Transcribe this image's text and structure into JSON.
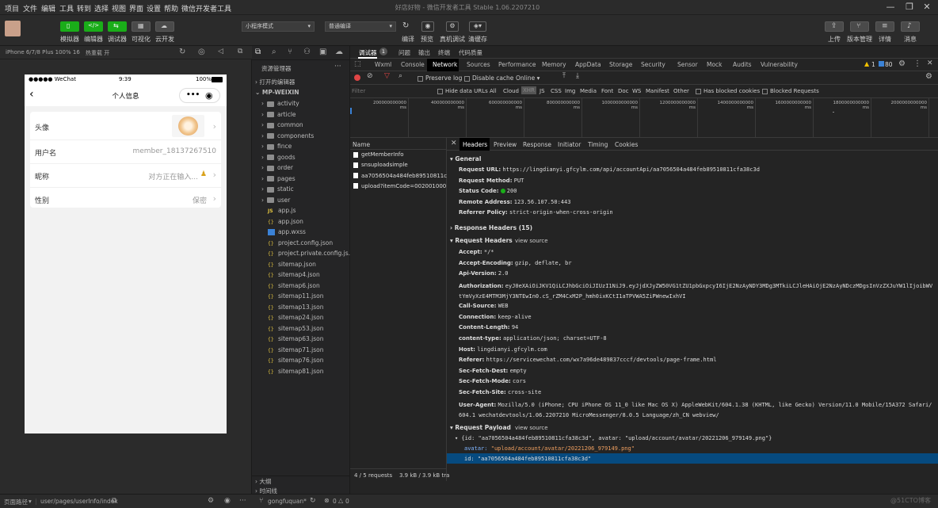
{
  "menubar": {
    "items": [
      "项目",
      "文件",
      "编辑",
      "工具",
      "转到",
      "选择",
      "视图",
      "界面",
      "设置",
      "帮助",
      "微信开发者工具"
    ],
    "window_title": "好店好物 - 微信开发者工具 Stable 1.06.2207210"
  },
  "toolbar": {
    "left_buttons": [
      "模拟器",
      "编辑器",
      "调试器",
      "可视化",
      "云开发"
    ],
    "mode_select": "小程序模式",
    "compile_select": "普通编译",
    "center_buttons": [
      "编译",
      "预览",
      "真机调试",
      "清缓存"
    ],
    "right_buttons": [
      "上传",
      "版本管理",
      "详情",
      "消息"
    ]
  },
  "simulator": {
    "device_select": "iPhone 6/7/8 Plus 100% 16",
    "hotreload": "热重载 开",
    "statusbar": {
      "carrier": "●●●●● WeChat",
      "time": "9:39",
      "battery": "100%"
    },
    "nav_title": "个人信息",
    "rows": [
      {
        "label": "头像",
        "value": ""
      },
      {
        "label": "用户名",
        "value": "member_18137267510"
      },
      {
        "label": "昵称",
        "value": "对方正在输入..."
      },
      {
        "label": "性别",
        "value": "保密"
      }
    ]
  },
  "explorer": {
    "title": "资源管理器",
    "open_editors": "打开的编辑器",
    "project": "MP-WEIXIN",
    "folders": [
      "activity",
      "article",
      "common",
      "components",
      "fince",
      "goods",
      "order",
      "pages",
      "static",
      "user"
    ],
    "files": [
      {
        "name": "app.js",
        "type": "js"
      },
      {
        "name": "app.json",
        "type": "json"
      },
      {
        "name": "app.wxss",
        "type": "wxss"
      },
      {
        "name": "project.config.json",
        "type": "json"
      },
      {
        "name": "project.private.config.js...",
        "type": "json"
      },
      {
        "name": "sitemap.json",
        "type": "json"
      },
      {
        "name": "sitemap4.json",
        "type": "json"
      },
      {
        "name": "sitemap6.json",
        "type": "json"
      },
      {
        "name": "sitemap11.json",
        "type": "json"
      },
      {
        "name": "sitemap13.json",
        "type": "json"
      },
      {
        "name": "sitemap24.json",
        "type": "json"
      },
      {
        "name": "sitemap53.json",
        "type": "json"
      },
      {
        "name": "sitemap63.json",
        "type": "json"
      },
      {
        "name": "sitemap71.json",
        "type": "json"
      },
      {
        "name": "sitemap76.json",
        "type": "json"
      },
      {
        "name": "sitemap81.json",
        "type": "json"
      }
    ],
    "outline": "大纲",
    "timeline": "时间线"
  },
  "devtools": {
    "top_tabs": [
      "调试器",
      "问题",
      "输出",
      "终端",
      "代码质量"
    ],
    "debugger_badge": "1",
    "panel_tabs": [
      "Wxml",
      "Console",
      "Network",
      "Sources",
      "Performance",
      "Memory",
      "AppData",
      "Storage",
      "Security",
      "Sensor",
      "Mock",
      "Audits",
      "Vulnerability"
    ],
    "warn_count": "1",
    "msg_count": "80",
    "preserve_log": "Preserve log",
    "disable_cache": "Disable cache",
    "throttle": "Online",
    "filter_placeholder": "Filter",
    "hide_data_urls": "Hide data URLs",
    "filter_types": [
      "All",
      "Cloud",
      "XHR",
      "JS",
      "CSS",
      "Img",
      "Media",
      "Font",
      "Doc",
      "WS",
      "Manifest",
      "Other"
    ],
    "has_blocked_cookies": "Has blocked cookies",
    "blocked_requests": "Blocked Requests",
    "timeline_ticks": [
      "200000000000 ms",
      "400000000000 ms",
      "600000000000 ms",
      "800000000000 ms",
      "1000000000000 ms",
      "1200000000000 ms",
      "1400000000000 ms",
      "1600000000000 ms",
      "1800000000000 ms",
      "2000000000000 ms"
    ],
    "name_header": "Name",
    "requests": [
      "getMemberInfo",
      "snsuploadsimple",
      "aa7056504a484feb89510811cf...",
      "upload?itemCode=002001000..."
    ],
    "detail_tabs": [
      "Headers",
      "Preview",
      "Response",
      "Initiator",
      "Timing",
      "Cookies"
    ],
    "general_title": "General",
    "general": [
      {
        "k": "Request URL:",
        "v": "https://lingdianyi.gfcylm.com/api/accountApi/aa7056504a484feb89510811cfa38c3d"
      },
      {
        "k": "Request Method:",
        "v": "PUT"
      },
      {
        "k": "Status Code:",
        "v": "200"
      },
      {
        "k": "Remote Address:",
        "v": "123.56.107.50:443"
      },
      {
        "k": "Referrer Policy:",
        "v": "strict-origin-when-cross-origin"
      }
    ],
    "response_headers_title": "Response Headers (15)",
    "request_headers_title": "Request Headers",
    "view_source": "view source",
    "request_headers": [
      {
        "k": "Accept:",
        "v": "*/*"
      },
      {
        "k": "Accept-Encoding:",
        "v": "gzip, deflate, br"
      },
      {
        "k": "Api-Version:",
        "v": "2.0"
      },
      {
        "k": "Authorization:",
        "v": "eyJ0eXAiOiJKV1QiLCJhbGciOiJIUzI1NiJ9.eyJjdXJyZW50VG1tZU1pbGxpcyI6IjE2NzAyNDY3MDg3MTkiLCJleHAiOjE2NzAyNDczMDgsInVzZXJuYW1lIjoibWVtYmVyXzE4MTM3MjY3NTEwIn0.cS_rZM4CxM2P_hmh0ixKCtI1aTPVWA5ZiPWnewIxhVI"
      },
      {
        "k": "Call-Source:",
        "v": "WEB"
      },
      {
        "k": "Connection:",
        "v": "keep-alive"
      },
      {
        "k": "Content-Length:",
        "v": "94"
      },
      {
        "k": "content-type:",
        "v": "application/json; charset=UTF-8"
      },
      {
        "k": "Host:",
        "v": "lingdianyi.gfcylm.com"
      },
      {
        "k": "Referer:",
        "v": "https://servicewechat.com/wx7a96de489837cccf/devtools/page-frame.html"
      },
      {
        "k": "Sec-Fetch-Dest:",
        "v": "empty"
      },
      {
        "k": "Sec-Fetch-Mode:",
        "v": "cors"
      },
      {
        "k": "Sec-Fetch-Site:",
        "v": "cross-site"
      },
      {
        "k": "User-Agent:",
        "v": "Mozilla/5.0 (iPhone; CPU iPhone OS 11_0 like Mac OS X) AppleWebKit/604.1.38 (KHTML, like Gecko) Version/11.0 Mobile/15A372 Safari/604.1 wechatdevtools/1.06.2207210 MicroMessenger/8.0.5 Language/zh_CN webview/"
      }
    ],
    "payload_title": "Request Payload",
    "payload_summary": "{id: \"aa7056504a484feb89510811cfa38c3d\", avatar: \"upload/account/avatar/20221206_979149.png\"}",
    "payload_avatar_key": "avatar:",
    "payload_avatar_val": "\"upload/account/avatar/20221206_979149.png\"",
    "payload_id_key": "id:",
    "payload_id_val": "\"aa7056504a484feb89510811cfa38c3d\"",
    "requests_count": "4 / 5 requests",
    "transfer": "3.9 kB / 3.9 kB tra"
  },
  "statusline": {
    "page_path_label": "页面路径",
    "page_path": "user/pages/userInfo/index",
    "user": "gongfuquan*",
    "errors": "0",
    "warnings": "0",
    "watermark": "@51CTO博客"
  },
  "colors": {
    "green": "#1aad19",
    "selected_row": "#064a7f",
    "accent_blue": "#3b82d6"
  }
}
